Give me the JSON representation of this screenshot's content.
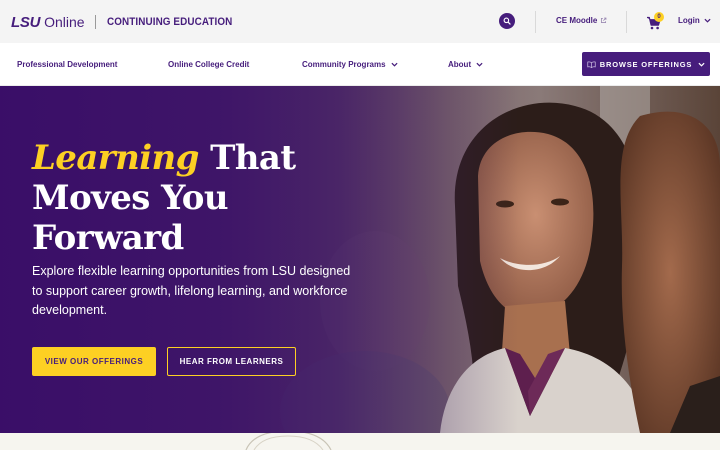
{
  "brand": {
    "logo_lsu": "LSU",
    "logo_online": "Online",
    "unit": "CONTINUING EDUCATION"
  },
  "topbar": {
    "moodle_label": "CE Moodle",
    "cart_count": "0",
    "login_label": "Login"
  },
  "nav": {
    "items": [
      {
        "label": "Professional Development"
      },
      {
        "label": "Online College Credit"
      },
      {
        "label": "Community Programs"
      },
      {
        "label": "About"
      }
    ],
    "browse_label": "BROWSE OFFERINGS"
  },
  "hero": {
    "title_accent": "Learning",
    "title_rest": "That Moves You Forward",
    "subtitle": "Explore flexible learning opportunities from LSU designed to support career growth, lifelong learning, and workforce development.",
    "primary_button": "VIEW OUR OFFERINGS",
    "secondary_button": "HEAR FROM LEARNERS"
  },
  "icons": {
    "search": "search-icon",
    "external": "external-link-icon",
    "cart": "cart-icon",
    "chevron": "chevron-down-icon",
    "book": "book-icon"
  },
  "colors": {
    "purple": "#461d7c",
    "gold": "#fdd023",
    "topbar_bg": "#f4f4f4"
  }
}
